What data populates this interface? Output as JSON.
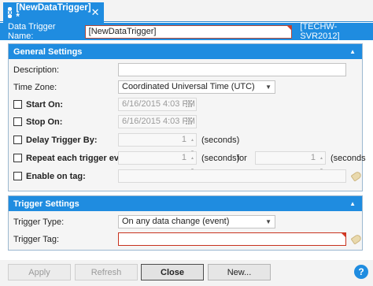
{
  "tab": {
    "title": "[NewDataTrigger] *",
    "app_icon": "app-icon",
    "close_icon": "close-icon"
  },
  "namebar": {
    "label": "Data Trigger  Name:",
    "name_value": "[NewDataTrigger]",
    "server": "[TECHW-SVR2012]"
  },
  "general": {
    "header": "General Settings",
    "description_label": "Description:",
    "description_value": "",
    "timezone_label": "Time Zone:",
    "timezone_value": "Coordinated Universal Time (UTC)",
    "start_label": "Start On:",
    "start_value": "6/16/2015 4:03 PM",
    "stop_label": "Stop On:",
    "stop_value": "6/16/2015 4:03 PM",
    "delay_label": "Delay Trigger By:",
    "delay_value": "1",
    "delay_unit": "(seconds)",
    "repeat_label": "Repeat each trigger every:",
    "repeat_value": "1",
    "repeat_unit": "(seconds)",
    "for_label": "for",
    "for_value": "1",
    "for_unit": "(seconds",
    "enable_label": "Enable on tag:",
    "enable_value": ""
  },
  "trigger": {
    "header": "Trigger Settings",
    "type_label": "Trigger Type:",
    "type_value": "On any data change (event)",
    "tag_label": "Trigger Tag:",
    "tag_value": ""
  },
  "buttons": {
    "apply": "Apply",
    "refresh": "Refresh",
    "close": "Close",
    "new": "New...",
    "help": "?"
  },
  "colors": {
    "accent": "#1f8ce0",
    "error": "#d43a26"
  }
}
